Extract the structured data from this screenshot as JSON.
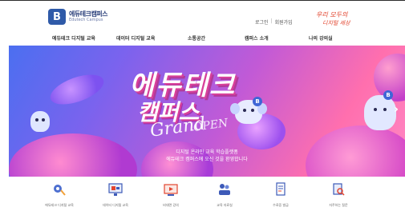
{
  "header": {
    "logo_mark": "B",
    "logo_text": "에듀테크캠퍼스",
    "logo_sub": "Edutech Campus",
    "utility_links": [
      "로그인",
      "회원가입"
    ],
    "slogan_line1": "우리 모두의",
    "slogan_line2": "디지털 세상"
  },
  "nav": {
    "items": [
      "에듀테크 디지털 교육",
      "데이터 디지털 교육",
      "소통공간",
      "캠퍼스 소개",
      "나의 강의실"
    ]
  },
  "hero": {
    "title_line1": "에듀테크",
    "title_line2": "캠퍼스",
    "script_text": "Grand",
    "script_text2": "OPEN",
    "subtitle_line1": "디지털 온라인 교육 학습플랫폼",
    "subtitle_line2": "에듀테크 캠퍼스에 오신 것을 환영합니다",
    "next_arrow": "›",
    "badge": "B"
  },
  "quick_links": [
    {
      "icon": "gear-bulb-icon",
      "label": "에듀테크 디지털 교육"
    },
    {
      "icon": "monitor-icon",
      "label": "데이터 디지털 교육"
    },
    {
      "icon": "video-icon",
      "label": "비대면 강의"
    },
    {
      "icon": "people-icon",
      "label": "교육 자료실"
    },
    {
      "icon": "document-icon",
      "label": "수료증 발급"
    },
    {
      "icon": "magnifier-icon",
      "label": "자주하는 질문"
    }
  ],
  "colors": {
    "brand_blue": "#2f5aa8",
    "slogan_red": "#e2452f",
    "hero_purple": "#7a63ee",
    "hero_pink": "#ff6fae"
  }
}
